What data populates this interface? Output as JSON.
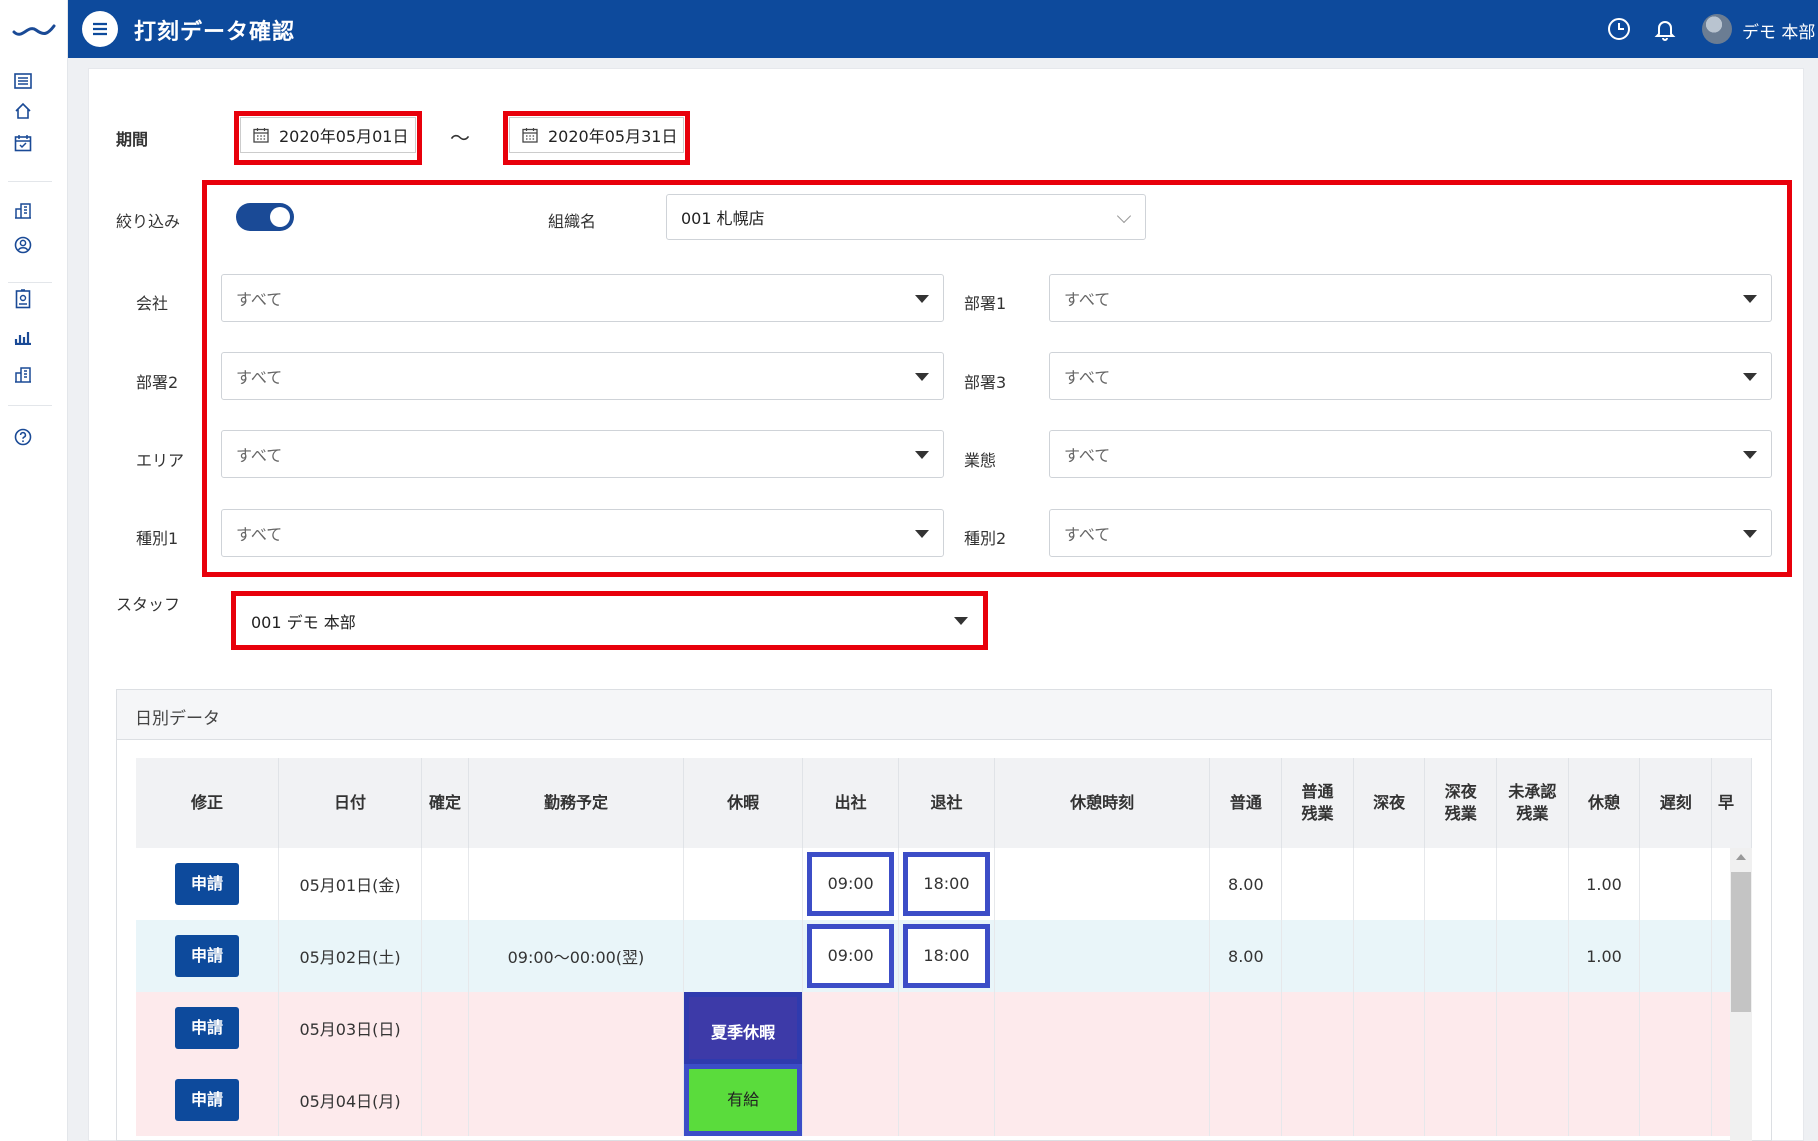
{
  "header": {
    "title": "打刻データ確認",
    "user_name": "デモ 本部"
  },
  "period": {
    "label": "期間",
    "start": "2020年05月01日",
    "separator": "〜",
    "end": "2020年05月31日"
  },
  "filter": {
    "label": "絞り込み",
    "enabled": true,
    "org_label": "組織名",
    "org_value": "001 札幌店",
    "fields": [
      {
        "label": "会社",
        "value": "すべて"
      },
      {
        "label": "部署1",
        "value": "すべて"
      },
      {
        "label": "部署2",
        "value": "すべて"
      },
      {
        "label": "部署3",
        "value": "すべて"
      },
      {
        "label": "エリア",
        "value": "すべて"
      },
      {
        "label": "業態",
        "value": "すべて"
      },
      {
        "label": "種別1",
        "value": "すべて"
      },
      {
        "label": "種別2",
        "value": "すべて"
      }
    ]
  },
  "staff": {
    "label": "スタッフ",
    "value": "001 デモ 本部"
  },
  "daily": {
    "title": "日別データ",
    "columns": [
      "修正",
      "日付",
      "確定",
      "勤務予定",
      "休暇",
      "出社",
      "退社",
      "休憩時刻",
      "普通",
      "普通\n残業",
      "深夜",
      "深夜\n残業",
      "未承認\n残業",
      "休憩",
      "遅刻",
      "早"
    ],
    "apply_label": "申請",
    "rows": [
      {
        "date": "05月01日(金)",
        "schedule": "",
        "leave": "",
        "in": "09:00",
        "out": "18:00",
        "normal": "8.00",
        "break": "1.00",
        "style": "white"
      },
      {
        "date": "05月02日(土)",
        "schedule": "09:00〜00:00(翌)",
        "leave": "",
        "in": "09:00",
        "out": "18:00",
        "normal": "8.00",
        "break": "1.00",
        "style": "blue"
      },
      {
        "date": "05月03日(日)",
        "schedule": "",
        "leave": "夏季休暇",
        "leave_color": "#3d3aa8",
        "in": "",
        "out": "",
        "normal": "",
        "break": "",
        "style": "pink"
      },
      {
        "date": "05月04日(月)",
        "schedule": "",
        "leave": "有給",
        "leave_color": "#5adc3c",
        "in": "",
        "out": "",
        "normal": "",
        "break": "",
        "style": "pink"
      }
    ]
  },
  "colors": {
    "brand": "#0d4a9c",
    "highlight": "#e8000b",
    "cell_outline": "#3c4dc7"
  },
  "icons": [
    "menu-icon",
    "clock-icon",
    "bell-icon",
    "calendar-icon",
    "logo-icon",
    "list-icon",
    "home-icon",
    "calendar-check-icon",
    "building-icon",
    "user-circle-icon",
    "badge-icon",
    "bar-chart-icon",
    "building2-icon",
    "help-icon"
  ]
}
